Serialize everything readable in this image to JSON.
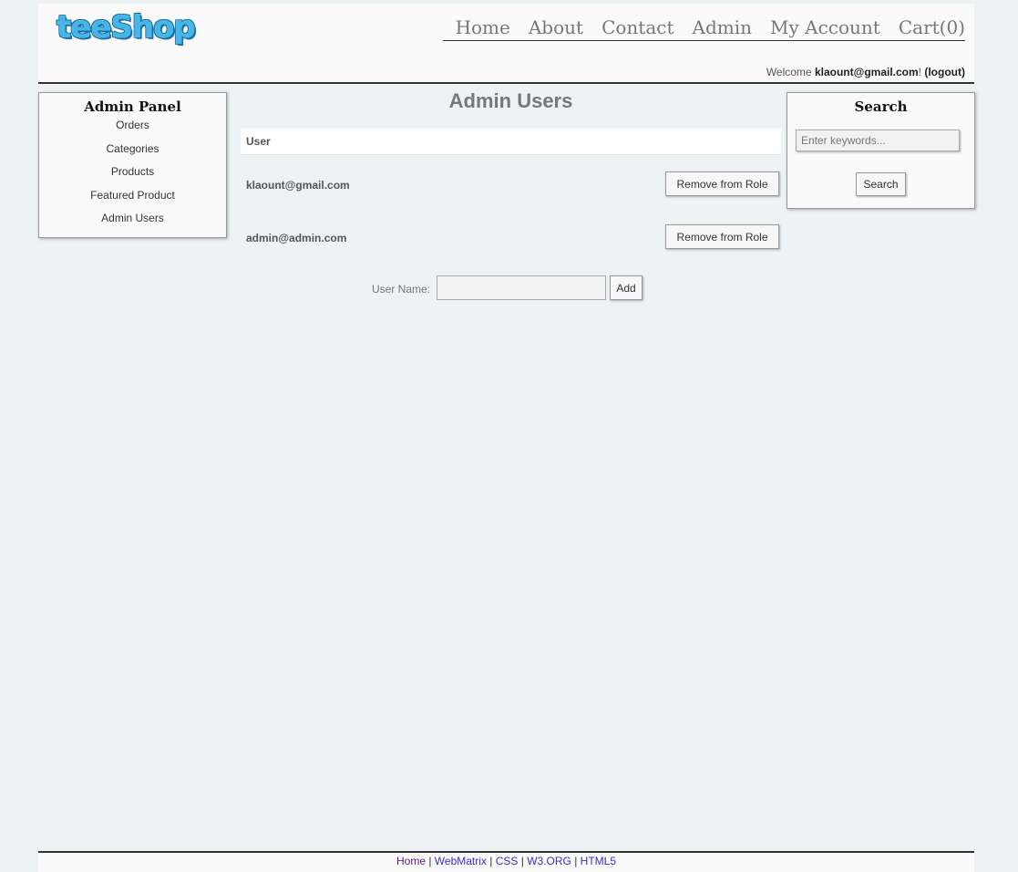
{
  "header": {
    "logo": "teeShop",
    "nav": [
      "Home",
      "About",
      "Contact",
      "Admin",
      "My Account",
      "Cart(0)"
    ],
    "welcome_prefix": "Welcome ",
    "welcome_user": "klaount@gmail.com",
    "welcome_suffix": "! ",
    "logout": "(logout)"
  },
  "admin_panel": {
    "title": "Admin Panel",
    "items": [
      "Orders",
      "Categories",
      "Products",
      "Featured Product",
      "Admin Users"
    ]
  },
  "main": {
    "title": "Admin Users",
    "column_header": "User",
    "users": [
      {
        "email": "klaount@gmail.com",
        "action": "Remove from Role"
      },
      {
        "email": "admin@admin.com",
        "action": "Remove from Role"
      }
    ],
    "add_form": {
      "label": "User Name:",
      "button": "Add",
      "value": ""
    }
  },
  "search_panel": {
    "title": "Search",
    "placeholder": "Enter keywords...",
    "button": "Search"
  },
  "footer": {
    "links": [
      "Home",
      "WebMatrix",
      "CSS",
      "W3.ORG",
      "HTML5"
    ],
    "separator": " | "
  },
  "colors": {
    "background": "#edf2f5",
    "link": "#3a2ec4",
    "logo": "#45b6e8"
  }
}
